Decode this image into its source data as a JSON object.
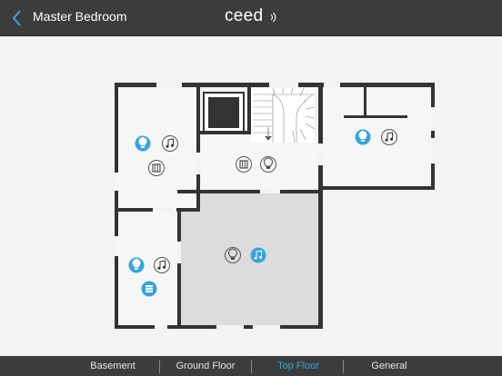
{
  "header": {
    "title": "Master Bedroom",
    "logo_text": "ceed",
    "back_icon": "chevron-left-icon"
  },
  "floor_tabs": [
    {
      "label": "Basement",
      "active": false
    },
    {
      "label": "Ground Floor",
      "active": false
    },
    {
      "label": "Top Floor",
      "active": true
    },
    {
      "label": "General",
      "active": false
    }
  ],
  "colors": {
    "header_bg": "#3c3c3c",
    "accent": "#34a4dc",
    "wall": "#333333",
    "selected_room": "#dcdcdc"
  },
  "rooms": [
    {
      "id": "room-left-top",
      "devices": [
        "bulb-icon-active",
        "music-icon",
        "blinds-icon"
      ]
    },
    {
      "id": "room-left-bottom",
      "devices": [
        "bulb-icon-active",
        "music-icon",
        "blinds-icon-active"
      ]
    },
    {
      "id": "room-hallway",
      "devices": [
        "blinds-icon",
        "bulb-icon"
      ]
    },
    {
      "id": "room-right",
      "devices": [
        "bulb-icon-active",
        "music-icon"
      ]
    },
    {
      "id": "room-master-bedroom",
      "selected": true,
      "devices": [
        "bulb-icon",
        "music-icon-active"
      ]
    }
  ]
}
